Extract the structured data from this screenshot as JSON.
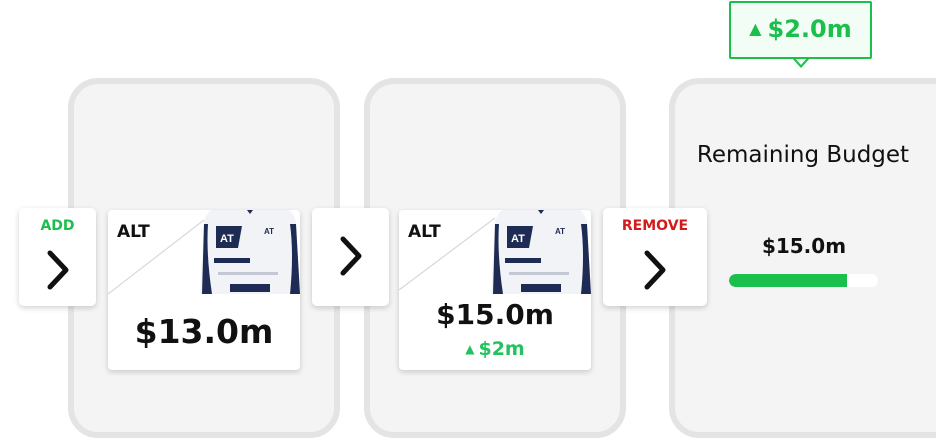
{
  "cards": [
    {
      "team": "ALT",
      "price": "$13.0m"
    },
    {
      "team": "ALT",
      "price": "$15.0m",
      "delta": "$2m",
      "delta_icon": "triangle-up-icon"
    }
  ],
  "buttons": {
    "add": {
      "label": "ADD",
      "icon": "chevron-right-icon"
    },
    "next": {
      "icon": "chevron-right-icon"
    },
    "remove": {
      "label": "REMOVE",
      "icon": "chevron-right-icon"
    }
  },
  "budget": {
    "title": "Remaining Budget",
    "amount": "$15.0m",
    "bar_fill_fraction": 0.79
  },
  "tooltip": {
    "text": "$2.0m",
    "icon": "triangle-up-icon"
  },
  "colors": {
    "positive": "#1bbf4b",
    "negative": "#d21b1b",
    "team_navy": "#1e2b54"
  }
}
